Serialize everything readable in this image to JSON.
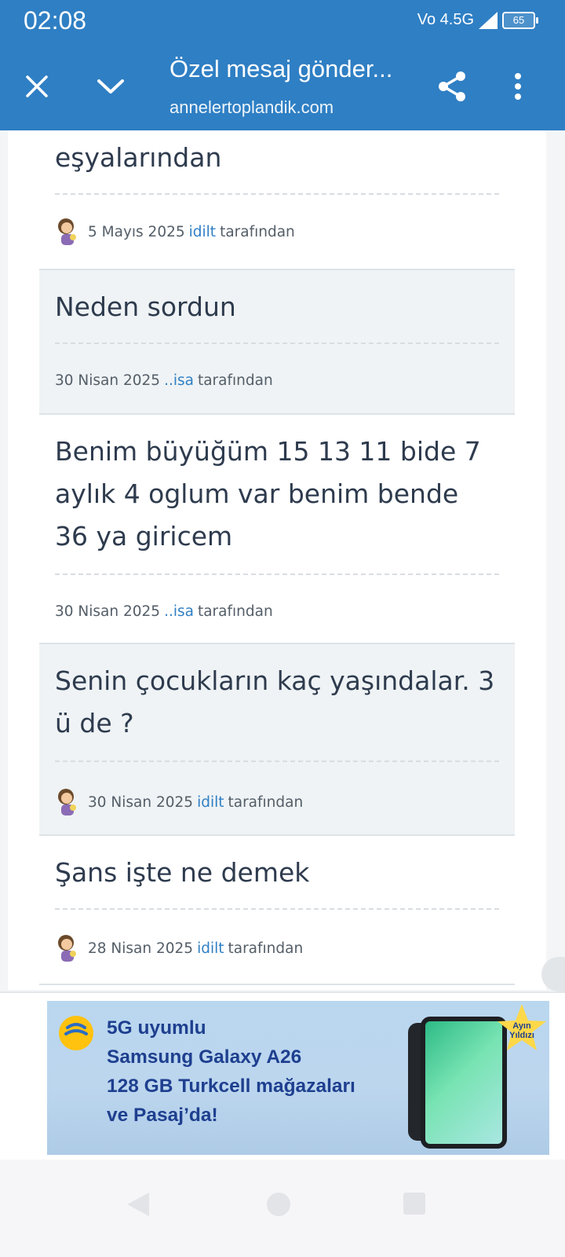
{
  "status_bar": {
    "time": "02:08",
    "network": "Vo 4.5G",
    "battery": "65"
  },
  "toolbar": {
    "title": "Özel mesaj gönder...",
    "subtitle": "annelertoplandik.com"
  },
  "posts": [
    {
      "text": "eşyalarından",
      "date": "5 Mayıs 2025",
      "author": "idilt",
      "suffix": "tarafından",
      "has_avatar": true
    },
    {
      "text": "Neden sordun",
      "date": "30 Nisan 2025",
      "author": "..isa",
      "suffix": "tarafından",
      "has_avatar": false
    },
    {
      "text": "Benim büyüğüm 15 13 11 bide 7 aylık 4 oglum var benim bende 36 ya giricem",
      "date": "30 Nisan 2025",
      "author": "..isa",
      "suffix": "tarafından",
      "has_avatar": false
    },
    {
      "text": "Senin çocukların kaç yaşındalar. 3 ü de ?",
      "date": "30 Nisan 2025",
      "author": "idilt",
      "suffix": "tarafından",
      "has_avatar": true
    },
    {
      "text": "Şans işte ne demek",
      "date": "28 Nisan 2025",
      "author": "idilt",
      "suffix": "tarafından",
      "has_avatar": true
    }
  ],
  "ad": {
    "line1": "5G uyumlu",
    "line2": "Samsung Galaxy A26",
    "line3": "128 GB Turkcell mağazaları",
    "line4": "ve Pasaj’da!",
    "badge_line1": "Ayın",
    "badge_line2": "Yıldızı"
  },
  "colors": {
    "toolbar": "#2f7fc4",
    "link": "#2f7fc4",
    "alt_post_bg": "#eff3f5",
    "ad_text": "#1e3f8f"
  }
}
